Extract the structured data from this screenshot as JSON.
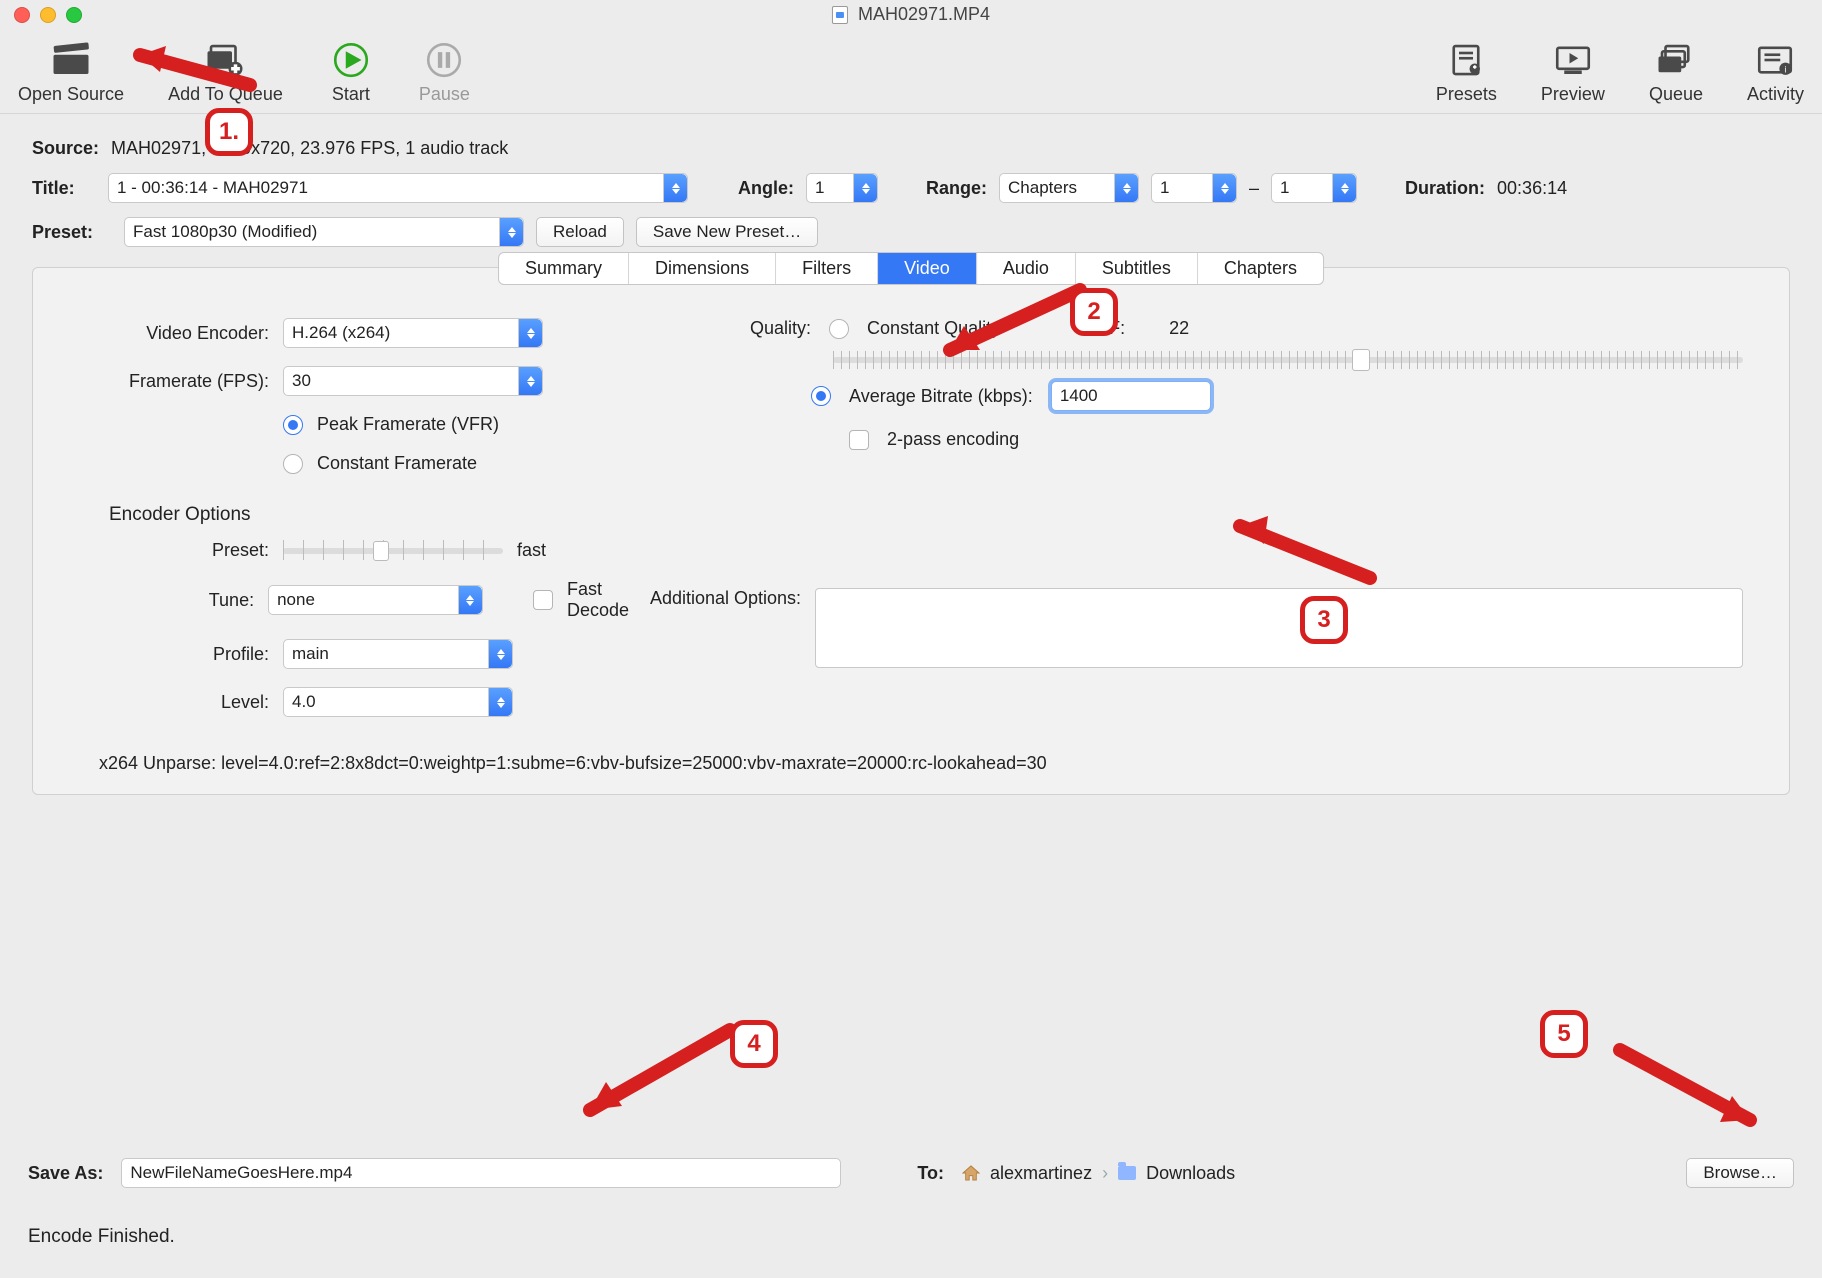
{
  "window": {
    "title": "MAH02971.MP4"
  },
  "toolbar": {
    "open_source": "Open Source",
    "add_to_queue": "Add To Queue",
    "start": "Start",
    "pause": "Pause",
    "presets": "Presets",
    "preview": "Preview",
    "queue": "Queue",
    "activity": "Activity"
  },
  "source": {
    "label": "Source:",
    "value": "MAH02971, 1280x720, 23.976 FPS, 1 audio track"
  },
  "title": {
    "label": "Title:",
    "value": "1 - 00:36:14 - MAH02971"
  },
  "angle": {
    "label": "Angle:",
    "value": "1"
  },
  "range": {
    "label": "Range:",
    "value": "Chapters",
    "from": "1",
    "sep": "–",
    "to": "1"
  },
  "duration": {
    "label": "Duration:",
    "value": "00:36:14"
  },
  "preset": {
    "label": "Preset:",
    "value": "Fast 1080p30 (Modified)",
    "reload": "Reload",
    "save_new": "Save New Preset…"
  },
  "tabs": [
    "Summary",
    "Dimensions",
    "Filters",
    "Video",
    "Audio",
    "Subtitles",
    "Chapters"
  ],
  "active_tab": "Video",
  "video": {
    "encoder_label": "Video Encoder:",
    "encoder": "H.264 (x264)",
    "fps_label": "Framerate (FPS):",
    "fps": "30",
    "peak_vfr": "Peak Framerate (VFR)",
    "constant_fr": "Constant Framerate",
    "quality_label": "Quality:",
    "constant_quality": "Constant Quality",
    "rf_label": "RF:",
    "rf_value": "22",
    "avg_bitrate_label": "Average Bitrate (kbps):",
    "avg_bitrate_value": "1400",
    "two_pass": "2-pass encoding"
  },
  "encoder_options": {
    "header": "Encoder Options",
    "preset_label": "Preset:",
    "preset_value": "fast",
    "tune_label": "Tune:",
    "tune_value": "none",
    "fast_decode": "Fast Decode",
    "profile_label": "Profile:",
    "profile_value": "main",
    "addl_label": "Additional Options:",
    "level_label": "Level:",
    "level_value": "4.0"
  },
  "x264_unparse": "x264 Unparse: level=4.0:ref=2:8x8dct=0:weightp=1:subme=6:vbv-bufsize=25000:vbv-maxrate=20000:rc-lookahead=30",
  "save": {
    "label": "Save As:",
    "filename": "NewFileNameGoesHere.mp4",
    "to_label": "To:",
    "path_user": "alexmartinez",
    "path_folder": "Downloads",
    "browse": "Browse…"
  },
  "status": "Encode Finished.",
  "annotations": {
    "b1": "1.",
    "b2": "2",
    "b3": "3",
    "b4": "4",
    "b5": "5"
  }
}
